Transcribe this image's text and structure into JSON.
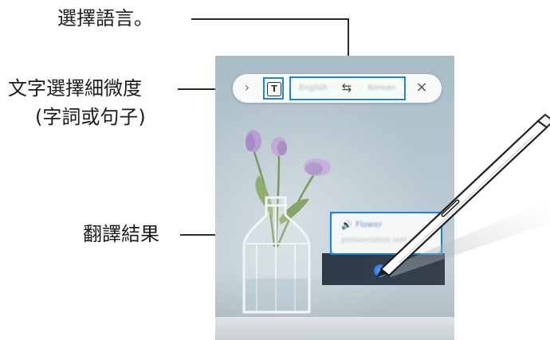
{
  "callouts": {
    "select_language": "選擇語言。",
    "granularity_line1": "文字選擇細微度",
    "granularity_line2": "(字詞或句子)",
    "result": "翻譯結果"
  },
  "toolbar": {
    "chevron": "›",
    "granularity_icon": "T",
    "source_language": "English",
    "swap_icon": "⇆",
    "target_language": "Korean",
    "close_icon": "×"
  },
  "translation": {
    "speaker_icon": "🔊",
    "word": "Flower",
    "pronunciation": "pronunciation text"
  },
  "colors": {
    "highlight": "#1686d8",
    "leader_line": "#2a2a2a"
  }
}
